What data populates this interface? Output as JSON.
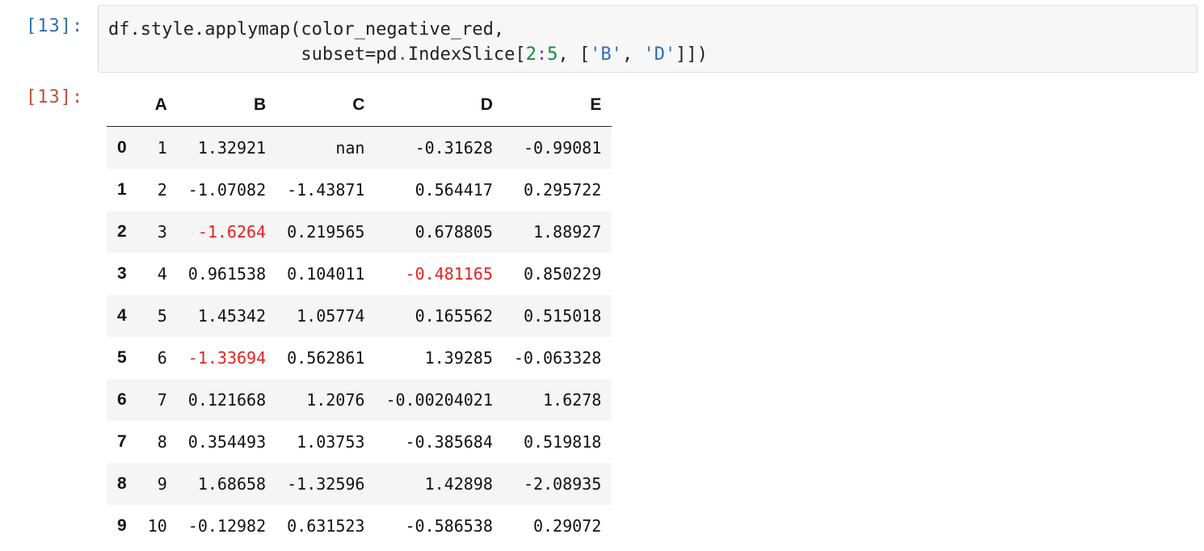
{
  "input_cell": {
    "prompt": "[13]:",
    "code_line1": "df.style.applymap(color_negative_red,",
    "code_line2_a": "                  subset=pd",
    "code_line2_dot": ".",
    "code_line2_b": "IndexSlice[",
    "code_line2_n1": "2",
    "code_line2_colon": ":",
    "code_line2_n2": "5",
    "code_line2_c": ", [",
    "code_line2_s1": "'B'",
    "code_line2_comma": ", ",
    "code_line2_s2": "'D'",
    "code_line2_end": "]])"
  },
  "output_cell": {
    "prompt": "[13]:"
  },
  "table": {
    "columns": [
      "",
      "A",
      "B",
      "C",
      "D",
      "E"
    ],
    "rows": [
      {
        "index": "0",
        "A": "1",
        "B": "1.32921",
        "C": "nan",
        "D": "-0.31628",
        "E": "-0.99081"
      },
      {
        "index": "1",
        "A": "2",
        "B": "-1.07082",
        "C": "-1.43871",
        "D": "0.564417",
        "E": "0.295722"
      },
      {
        "index": "2",
        "A": "3",
        "B": "-1.6264",
        "C": "0.219565",
        "D": "0.678805",
        "E": "1.88927"
      },
      {
        "index": "3",
        "A": "4",
        "B": "0.961538",
        "C": "0.104011",
        "D": "-0.481165",
        "E": "0.850229"
      },
      {
        "index": "4",
        "A": "5",
        "B": "1.45342",
        "C": "1.05774",
        "D": "0.165562",
        "E": "0.515018"
      },
      {
        "index": "5",
        "A": "6",
        "B": "-1.33694",
        "C": "0.562861",
        "D": "1.39285",
        "E": "-0.063328"
      },
      {
        "index": "6",
        "A": "7",
        "B": "0.121668",
        "C": "1.2076",
        "D": "-0.00204021",
        "E": "1.6278"
      },
      {
        "index": "7",
        "A": "8",
        "B": "0.354493",
        "C": "1.03753",
        "D": "-0.385684",
        "E": "0.519818"
      },
      {
        "index": "8",
        "A": "9",
        "B": "1.68658",
        "C": "-1.32596",
        "D": "1.42898",
        "E": "-2.08935"
      },
      {
        "index": "9",
        "A": "10",
        "B": "-0.12982",
        "C": "0.631523",
        "D": "-0.586538",
        "E": "0.29072"
      }
    ],
    "highlighted_cells": [
      {
        "row": 2,
        "col": "B"
      },
      {
        "row": 3,
        "col": "D"
      },
      {
        "row": 5,
        "col": "B"
      }
    ],
    "highlight_color": "#e8211f",
    "stripe_color": "#f5f5f5"
  }
}
